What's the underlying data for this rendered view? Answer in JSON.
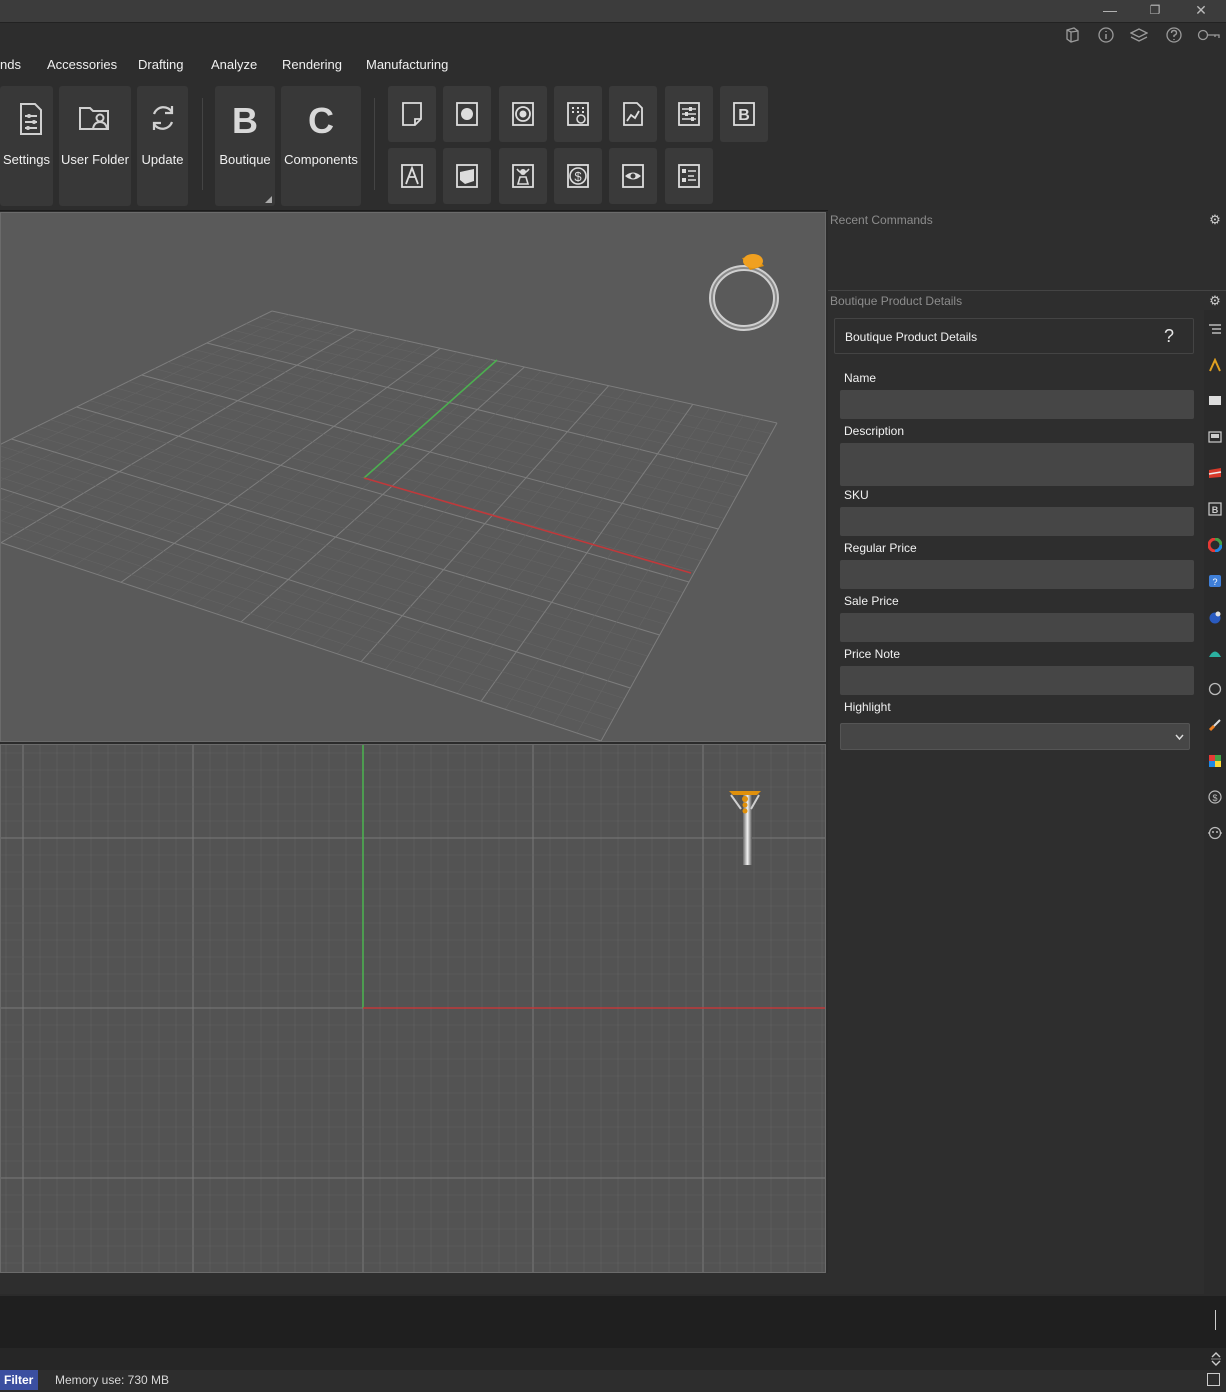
{
  "window": {
    "minimize_glyph": "—",
    "restore_glyph": "❐",
    "close_glyph": "✕"
  },
  "util_icons": [
    "cube-icon",
    "info-icon",
    "layers-icon",
    "help-icon",
    "key-icon"
  ],
  "menu": {
    "items": [
      {
        "label": "nds"
      },
      {
        "label": "Accessories"
      },
      {
        "label": "Drafting"
      },
      {
        "label": "Analyze"
      },
      {
        "label": "Rendering"
      },
      {
        "label": "Manufacturing"
      }
    ]
  },
  "ribbon": {
    "settings_label": "Settings",
    "user_folder_label": "User Folder",
    "update_label": "Update",
    "boutique_label": "Boutique",
    "boutique_letter": "B",
    "components_label": "Components",
    "components_letter": "C",
    "small_icons_row1": [
      "document-icon",
      "circle-icon",
      "gem-icon",
      "calendar-icon",
      "chart-icon",
      "sliders-icon",
      "boutique-b-icon"
    ],
    "small_icons_row2": [
      "text-a-icon",
      "box-icon",
      "bust-icon",
      "dollar-icon",
      "eye-icon",
      "tree-list-icon"
    ]
  },
  "panels": {
    "recent_commands_title": "Recent Commands",
    "product_details_title": "Boutique Product Details",
    "product_details_box_title": "Boutique Product Details",
    "help_glyph": "?"
  },
  "form": {
    "name_label": "Name",
    "name_value": "",
    "description_label": "Description",
    "description_value": "",
    "sku_label": "SKU",
    "sku_value": "",
    "regular_price_label": "Regular Price",
    "regular_price_value": "",
    "sale_price_label": "Sale Price",
    "sale_price_value": "",
    "price_note_label": "Price Note",
    "price_note_value": "",
    "highlight_label": "Highlight",
    "highlight_value": ""
  },
  "side_icons": [
    "list-icon",
    "draft-icon",
    "display-icon",
    "panel-icon",
    "material-icon",
    "boutique-icon",
    "color-wheel-icon",
    "help-book-icon",
    "gem-blue-icon",
    "dome-icon",
    "circle-outline-icon",
    "brush-icon",
    "palette-icon",
    "dollar-circle-icon",
    "robot-icon"
  ],
  "status": {
    "filter_label": "Filter",
    "memory_label": "Memory use: 730 MB"
  },
  "colors": {
    "accent_orange": "#e0900c",
    "axis_green": "#4caf50",
    "axis_red": "#c0393b",
    "filter_blue": "#3b4fa0"
  }
}
